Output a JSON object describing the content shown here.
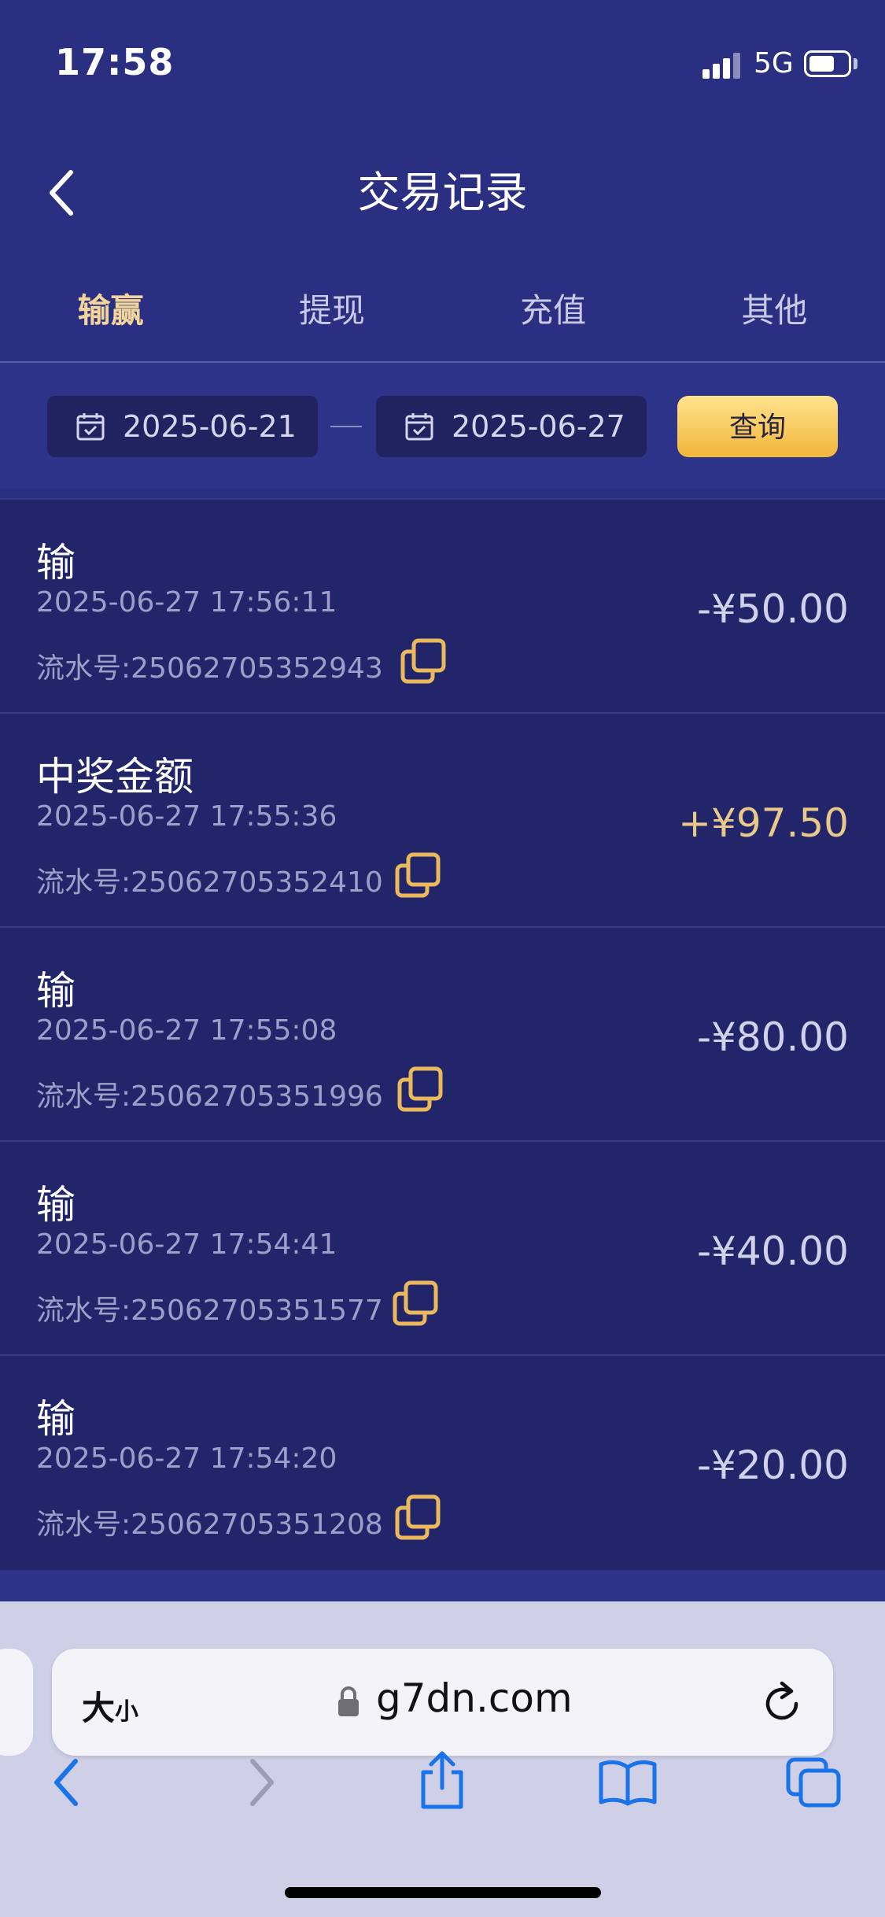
{
  "status": {
    "time": "17:58",
    "network": "5G"
  },
  "header": {
    "title": "交易记录"
  },
  "tabs": [
    {
      "label": "输赢",
      "active": true
    },
    {
      "label": "提现",
      "active": false
    },
    {
      "label": "充值",
      "active": false
    },
    {
      "label": "其他",
      "active": false
    }
  ],
  "filter": {
    "start_date": "2025-06-21",
    "separator": "—",
    "end_date": "2025-06-27",
    "query_label": "查询"
  },
  "records": [
    {
      "type": "输",
      "time": "2025-06-27 17:56:11",
      "serial": "流水号:25062705352943",
      "amount": "-¥50.00"
    },
    {
      "type": "中奖金额",
      "time": "2025-06-27 17:55:36",
      "serial": "流水号:25062705352410",
      "amount": "+¥97.50"
    },
    {
      "type": "输",
      "time": "2025-06-27 17:55:08",
      "serial": "流水号:25062705351996",
      "amount": "-¥80.00"
    },
    {
      "type": "输",
      "time": "2025-06-27 17:54:41",
      "serial": "流水号:25062705351577",
      "amount": "-¥40.00"
    },
    {
      "type": "输",
      "time": "2025-06-27 17:54:20",
      "serial": "流水号:25062705351208",
      "amount": "-¥20.00"
    }
  ],
  "browser": {
    "text_size_big": "大",
    "text_size_small": "小",
    "url": "g7dn.com"
  },
  "colors": {
    "background": "#2b2f82",
    "list_bg": "#22256a",
    "accent_gold": "#f2d59a",
    "win_amount": "#e8c98a"
  }
}
